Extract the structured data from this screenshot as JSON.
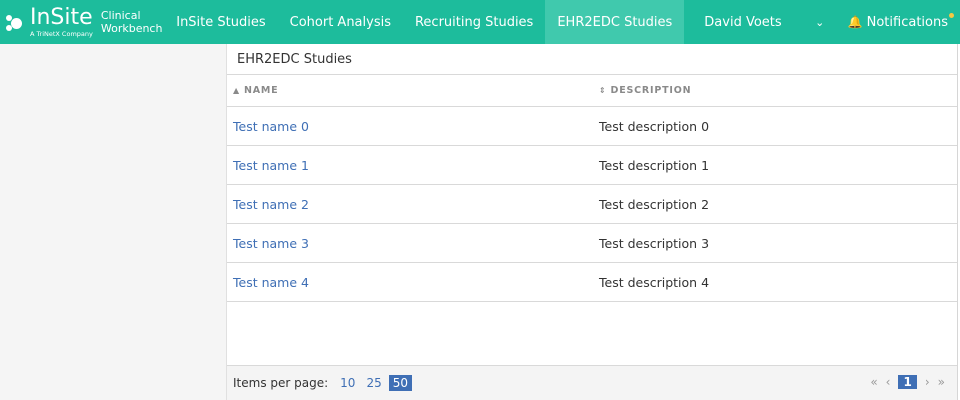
{
  "logo": {
    "name": "InSite",
    "sub": "A TriNetX Company",
    "product_line1": "Clinical",
    "product_line2": "Workbench"
  },
  "nav": {
    "items": [
      {
        "label": "InSite Studies"
      },
      {
        "label": "Cohort Analysis"
      },
      {
        "label": "Recruiting Studies"
      },
      {
        "label": "EHR2EDC Studies"
      }
    ],
    "active_index": 3,
    "user": "David Voets",
    "caret_icon": "chevron-down-icon",
    "notifications": "Notifications",
    "bell_icon": "bell-icon",
    "notification_dot_color": "#f5c842"
  },
  "main": {
    "title": "EHR2EDC Studies",
    "columns": {
      "name": "NAME",
      "description": "DESCRIPTION"
    },
    "rows": [
      {
        "name": "Test name 0",
        "description": "Test description 0"
      },
      {
        "name": "Test name 1",
        "description": "Test description 1"
      },
      {
        "name": "Test name 2",
        "description": "Test description 2"
      },
      {
        "name": "Test name 3",
        "description": "Test description 3"
      },
      {
        "name": "Test name 4",
        "description": "Test description 4"
      }
    ]
  },
  "footer": {
    "items_per_page_label": "Items per page:",
    "page_sizes": [
      "10",
      "25",
      "50"
    ],
    "selected_page_size": "50",
    "first": "«",
    "prev": "‹",
    "current_page": "1",
    "next": "›",
    "last": "»"
  },
  "colors": {
    "brand": "#1dbc9c",
    "active_tab": "#40c9ad",
    "link": "#3f6fb5"
  }
}
